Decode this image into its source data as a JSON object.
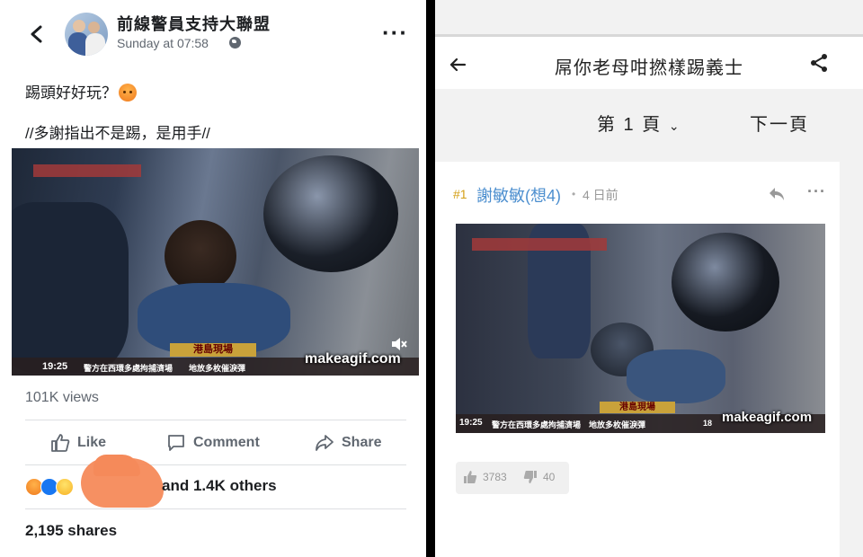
{
  "facebook": {
    "page_name": "前線警員支持大聯盟",
    "timestamp": "Sunday at 07:58",
    "post_line1": "踢頭好好玩？",
    "post_line2": "//多謝指出不是踢，是用手//",
    "video": {
      "ticker_title": "港島現場",
      "ticker_time": "19:25",
      "ticker_text": "警方在西環多處拘捕濟場　　地放多枚催淚彈",
      "watermark": "makeagif.com"
    },
    "views": "101K views",
    "actions": {
      "like": "Like",
      "comment": "Comment",
      "share": "Share"
    },
    "reactions_text": "and 1.4K others",
    "shares": "2,195 shares",
    "icons": {
      "back": "chevron-left-icon",
      "more": "more-dots-icon",
      "privacy": "globe-icon"
    }
  },
  "lihkg": {
    "thread_title": "屌你老母咁撚樣踢義士",
    "page_selector": "第 1 頁",
    "next_page": "下一頁",
    "post": {
      "number": "#1",
      "author": "謝敏敏(想4)",
      "time_ago": "4 日前",
      "video": {
        "ticker_title": "港島現場",
        "ticker_time": "19:25",
        "ticker_text": "警方在西環多處拘捕濟場　地放多枚催淚彈",
        "ticker_right": "18",
        "watermark": "makeagif.com"
      },
      "upvotes": "3783",
      "downvotes": "40"
    },
    "colors": {
      "author": "#4d8fcf",
      "post_number": "#d4a017"
    }
  }
}
